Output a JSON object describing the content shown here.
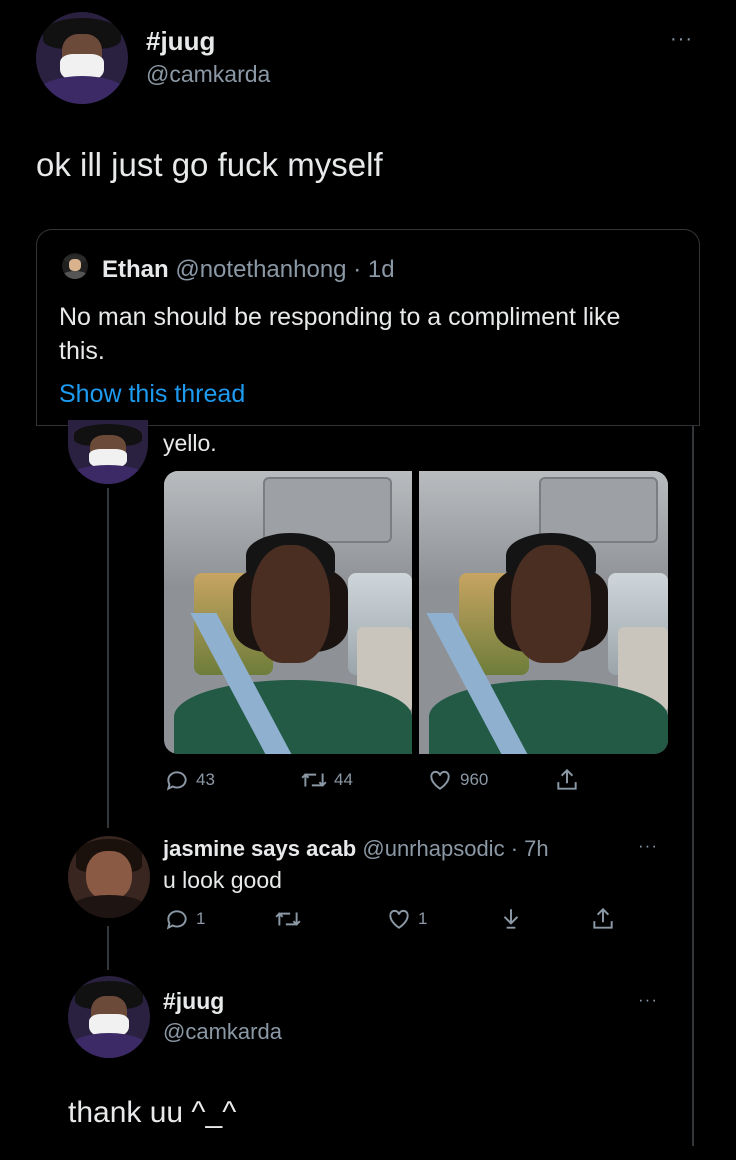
{
  "main_tweet": {
    "display_name": "#juug",
    "handle": "@camkarda",
    "text": "ok ill just go fuck myself"
  },
  "quoted_tweet": {
    "display_name": "Ethan",
    "handle": "@notethanhong",
    "separator": "·",
    "time": "1d",
    "text_line1": "No man should be responding to a compliment like",
    "text_line2": "this.",
    "show_thread": "Show this thread"
  },
  "inner_tweet": {
    "text": "yello.",
    "replies": "43",
    "retweets": "44",
    "likes": "960"
  },
  "reply_1": {
    "display_name": "jasmine says acab",
    "handle": "@unrhapsodic",
    "separator": "·",
    "time": "7h",
    "text": "u look good",
    "replies": "1",
    "likes": "1"
  },
  "reply_2": {
    "display_name": "#juug",
    "handle": "@camkarda",
    "text": "thank uu ^_^"
  },
  "icons": {
    "reply": "reply-icon",
    "retweet": "retweet-icon",
    "like": "heart-icon",
    "share": "share-icon",
    "download": "download-icon",
    "more": "more-icon"
  },
  "colors": {
    "background": "#000000",
    "text": "#e7e9ea",
    "secondary": "#8b98a5",
    "link": "#1d9bf0",
    "border": "#333639"
  },
  "more_glyph": "···"
}
